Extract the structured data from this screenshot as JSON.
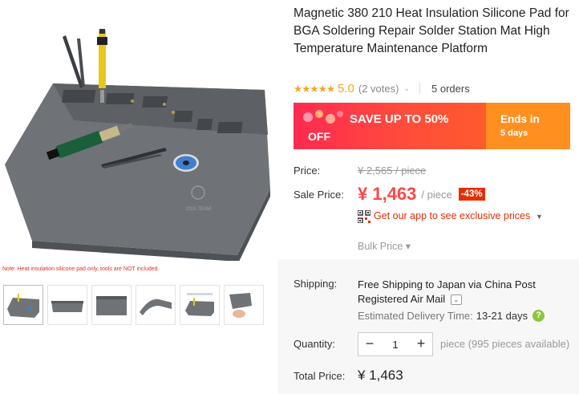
{
  "product": {
    "title": "Magnetic 380 210 Heat Insulation Silicone Pad for BGA Soldering Repair Solder Station Mat High Temperature Maintenance Platform",
    "image_note": "Note: Heat insulation silicone pad only, tools are NOT included.",
    "mat_logo_text": "OSS TEAM"
  },
  "gallery": {
    "thumbnails": [
      "mat with tools",
      "mat front view",
      "mat top view",
      "mat curved",
      "mat detail",
      "mat in hand"
    ]
  },
  "rating": {
    "stars": "★★★★★",
    "value": "5.0",
    "votes": "(2 votes)",
    "orders": "5 orders"
  },
  "promo": {
    "save_text": "SAVE UP TO 50%",
    "off_text": "OFF",
    "ends_in": "Ends in",
    "ends_days": "5 days",
    "colors": {
      "left": "#ff2a52",
      "right": "#ff8f1f"
    }
  },
  "price": {
    "label": "Price:",
    "original": "¥ 2,565 / piece",
    "sale_label": "Sale Price:",
    "sale": "¥ 1,463",
    "per_piece": "/ piece",
    "discount": "-43%"
  },
  "app_offer": {
    "text": "Get our app to see exclusive prices",
    "icon": "qr-code-icon"
  },
  "bulk_price": "Bulk Price ▾",
  "shipping": {
    "label": "Shipping:",
    "method": "Free Shipping to Japan via China Post Registered Air Mail",
    "dropdown_glyph": "⌄",
    "delivery_label": "Estimated Delivery Time:",
    "delivery_value": "13-21 days",
    "help_glyph": "?"
  },
  "quantity": {
    "label": "Quantity:",
    "value": "1",
    "minus": "−",
    "plus": "+",
    "available": "piece (995 pieces available)"
  },
  "total": {
    "label": "Total Price:",
    "value": "¥ 1,463"
  }
}
